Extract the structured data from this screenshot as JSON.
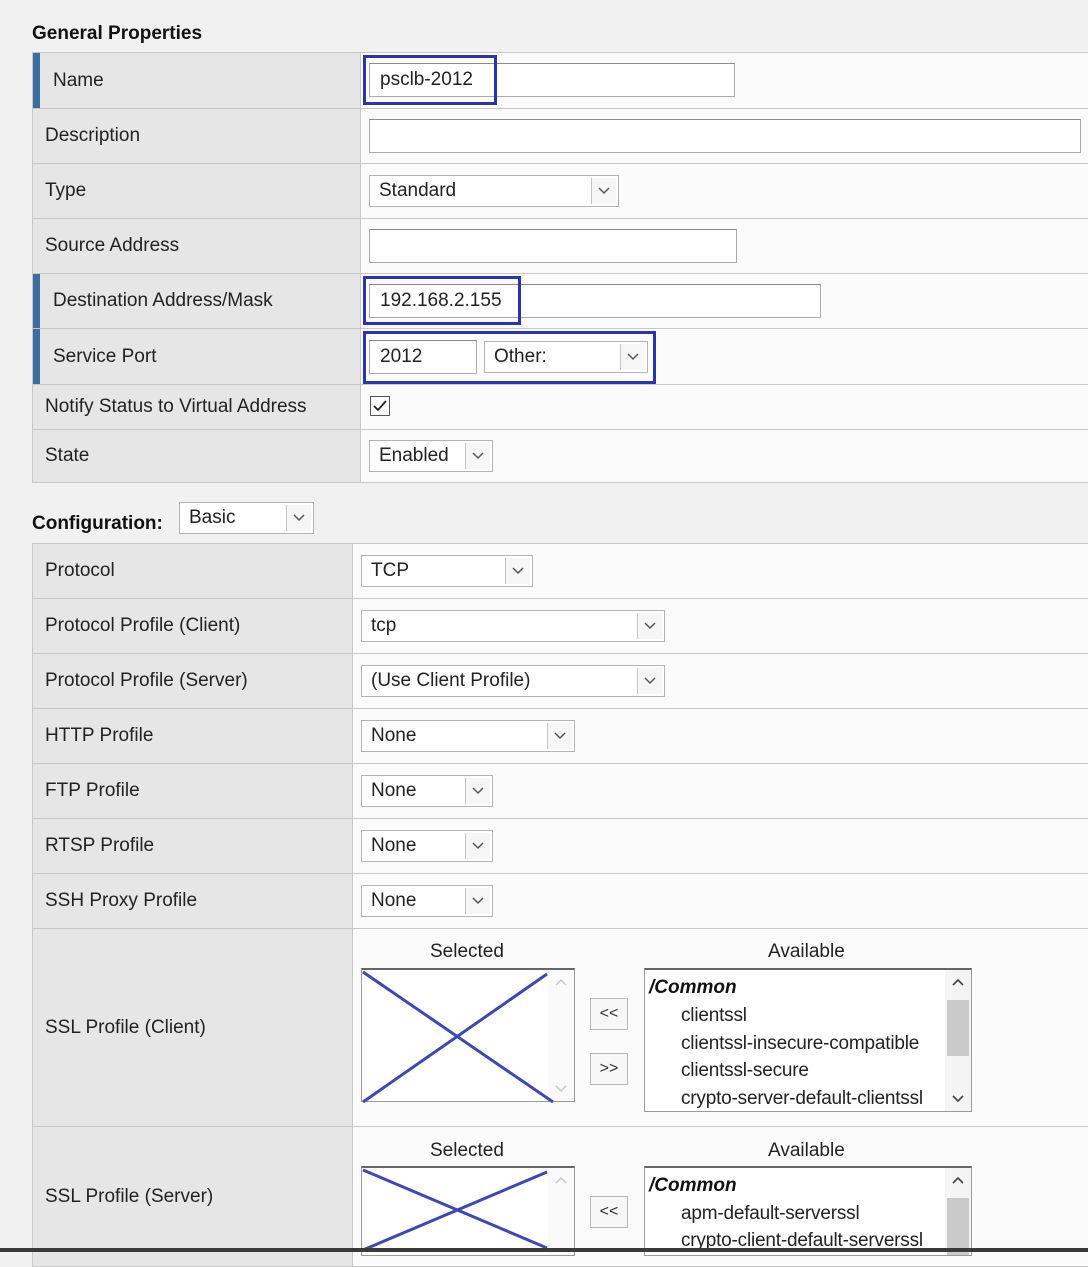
{
  "general": {
    "title": "General Properties",
    "fields": {
      "name": {
        "label": "Name",
        "value": "psclb-2012"
      },
      "description": {
        "label": "Description",
        "value": ""
      },
      "type": {
        "label": "Type",
        "value": "Standard"
      },
      "source_address": {
        "label": "Source Address",
        "value": ""
      },
      "destination": {
        "label": "Destination Address/Mask",
        "value": "192.168.2.155"
      },
      "service_port": {
        "label": "Service Port",
        "value": "2012",
        "select": "Other:"
      },
      "notify": {
        "label": "Notify Status to Virtual Address",
        "checked": true
      },
      "state": {
        "label": "State",
        "value": "Enabled"
      }
    }
  },
  "configuration": {
    "title": "Configuration:",
    "mode": "Basic",
    "fields": {
      "protocol": {
        "label": "Protocol",
        "value": "TCP"
      },
      "protocol_profile_client": {
        "label": "Protocol Profile (Client)",
        "value": "tcp"
      },
      "protocol_profile_server": {
        "label": "Protocol Profile (Server)",
        "value": "(Use Client Profile)"
      },
      "http_profile": {
        "label": "HTTP Profile",
        "value": "None"
      },
      "ftp_profile": {
        "label": "FTP Profile",
        "value": "None"
      },
      "rtsp_profile": {
        "label": "RTSP Profile",
        "value": "None"
      },
      "ssh_proxy_profile": {
        "label": "SSH Proxy Profile",
        "value": "None"
      }
    },
    "ssl_client": {
      "label": "SSL Profile (Client)",
      "selected_header": "Selected",
      "available_header": "Available",
      "group": "/Common",
      "available": [
        "clientssl",
        "clientssl-insecure-compatible",
        "clientssl-secure",
        "crypto-server-default-clientssl"
      ],
      "move_left": "<<",
      "move_right": ">>"
    },
    "ssl_server": {
      "label": "SSL Profile (Server)",
      "selected_header": "Selected",
      "available_header": "Available",
      "group": "/Common",
      "available": [
        "apm-default-serverssl",
        "crypto-client-default-serverssl"
      ],
      "move_left": "<<"
    }
  },
  "colors": {
    "highlight": "#2a34b0",
    "required_marker": "#3d6ea0"
  }
}
